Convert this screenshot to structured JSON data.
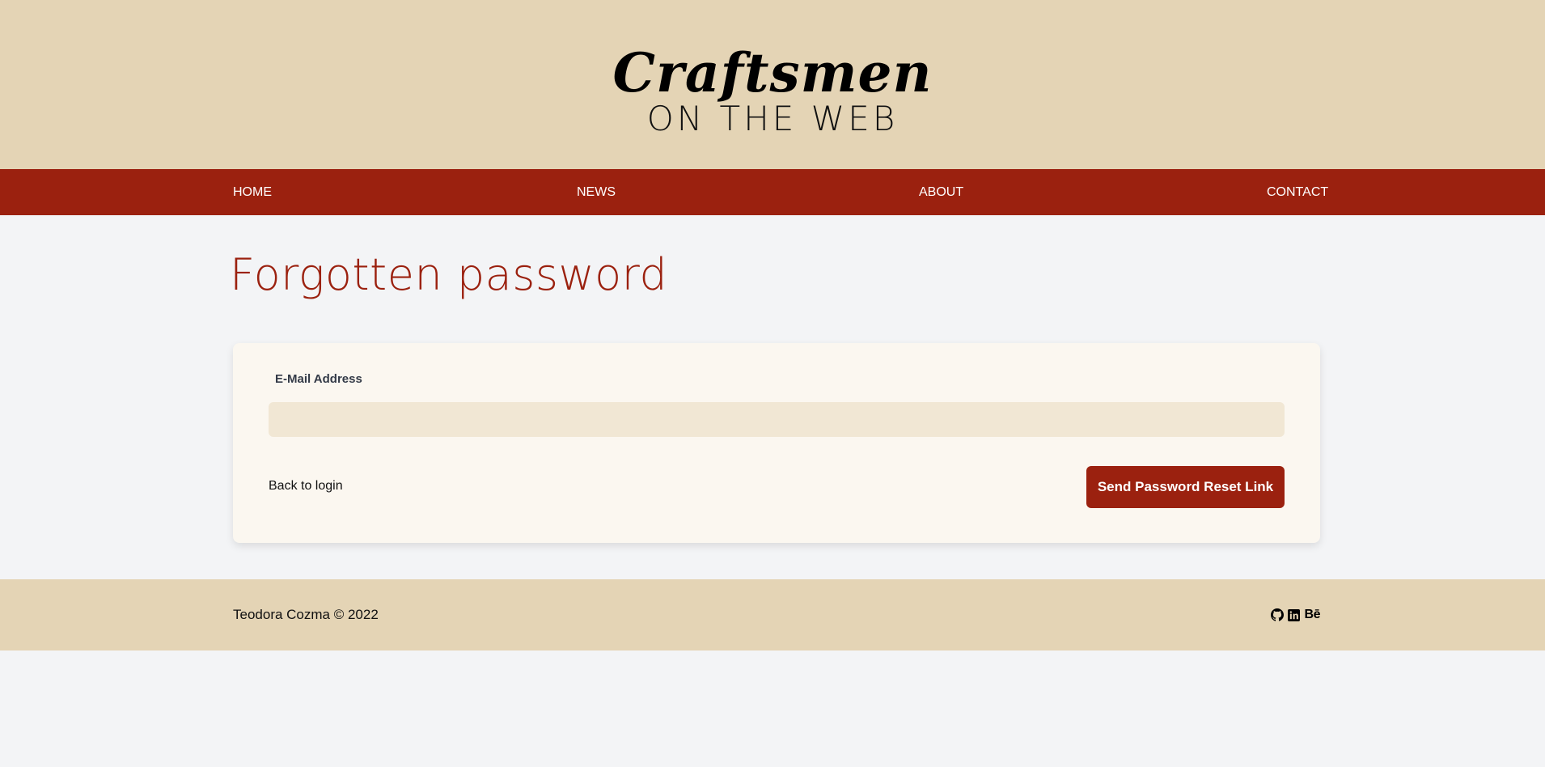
{
  "header": {
    "logo_main": "Craftsmen",
    "logo_sub": "ON THE WEB"
  },
  "nav": {
    "items": [
      {
        "label": "HOME"
      },
      {
        "label": "NEWS"
      },
      {
        "label": "ABOUT"
      },
      {
        "label": "CONTACT"
      }
    ]
  },
  "main": {
    "title": "Forgotten password",
    "form": {
      "email_label": "E-Mail Address",
      "email_value": "",
      "email_placeholder": "",
      "back_link": "Back to login",
      "submit_label": "Send Password Reset Link"
    }
  },
  "footer": {
    "copyright": "Teodora Cozma © 2022",
    "icons": [
      "github-icon",
      "linkedin-icon",
      "behance-icon"
    ],
    "behance_text": "Bē"
  },
  "colors": {
    "brand_red": "#9b210f",
    "header_beige": "#e4d4b5",
    "card_bg": "#fbf7f0",
    "input_bg": "#f1e7d4",
    "page_bg": "#f3f4f6"
  }
}
